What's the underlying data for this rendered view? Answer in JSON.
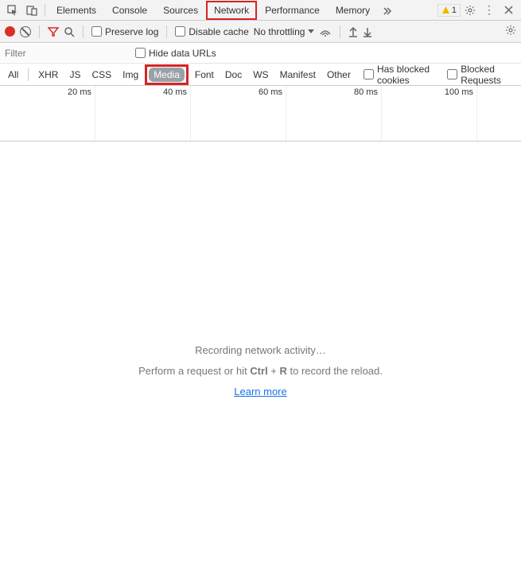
{
  "tabs": {
    "elements": "Elements",
    "console": "Console",
    "sources": "Sources",
    "network": "Network",
    "performance": "Performance",
    "memory": "Memory"
  },
  "warning_count": "1",
  "toolbar": {
    "preserve_log": "Preserve log",
    "disable_cache": "Disable cache",
    "throttling": "No throttling"
  },
  "filter": {
    "placeholder": "Filter",
    "hide_data_urls": "Hide data URLs"
  },
  "types": {
    "all": "All",
    "xhr": "XHR",
    "js": "JS",
    "css": "CSS",
    "img": "Img",
    "media": "Media",
    "font": "Font",
    "doc": "Doc",
    "ws": "WS",
    "manifest": "Manifest",
    "other": "Other",
    "has_blocked_cookies": "Has blocked cookies",
    "blocked_requests": "Blocked Requests"
  },
  "timeline": {
    "t1": "20 ms",
    "t2": "40 ms",
    "t3": "60 ms",
    "t4": "80 ms",
    "t5": "100 ms"
  },
  "empty": {
    "line1": "Recording network activity…",
    "line2a": "Perform a request or hit ",
    "line2b": "Ctrl",
    "line2c": " + ",
    "line2d": "R",
    "line2e": " to record the reload.",
    "learn": "Learn more"
  }
}
